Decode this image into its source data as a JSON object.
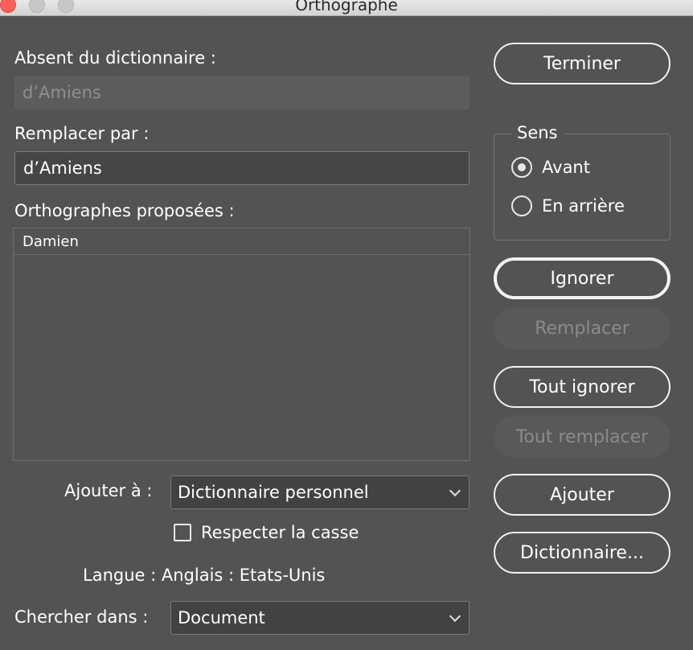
{
  "window": {
    "title": "Orthographe"
  },
  "not_in_dictionary": {
    "label": "Absent du dictionnaire :",
    "value": "d’Amiens"
  },
  "replace_with": {
    "label": "Remplacer par :",
    "value": "d’Amiens"
  },
  "suggestions": {
    "label": "Orthographes proposées :",
    "items": [
      "Damien"
    ]
  },
  "add_to": {
    "label": "Ajouter à :",
    "selected": "Dictionnaire personnel"
  },
  "case_sensitive": {
    "label": "Respecter la casse",
    "checked": false
  },
  "language": {
    "text": "Langue : Anglais : Etats-Unis"
  },
  "search_in": {
    "label": "Chercher dans :",
    "selected": "Document"
  },
  "direction": {
    "title": "Sens",
    "options": [
      {
        "label": "Avant",
        "selected": true
      },
      {
        "label": "En arrière",
        "selected": false
      }
    ]
  },
  "buttons": {
    "done": "Terminer",
    "ignore": "Ignorer",
    "replace": "Remplacer",
    "ignore_all": "Tout ignorer",
    "replace_all": "Tout remplacer",
    "add": "Ajouter",
    "dictionary": "Dictionnaire..."
  }
}
